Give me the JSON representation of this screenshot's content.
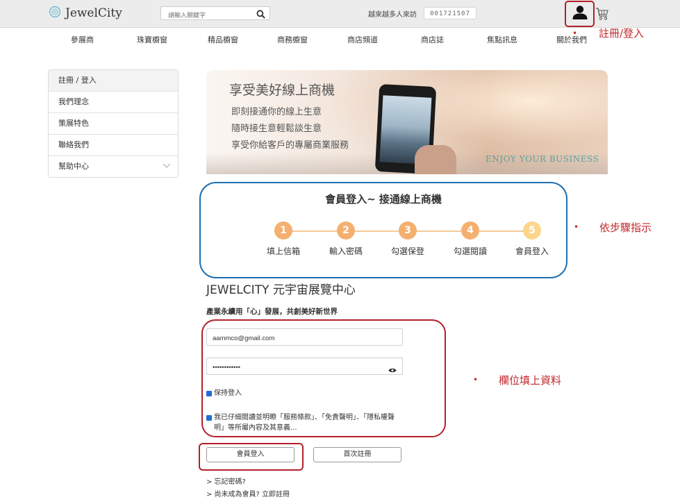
{
  "header": {
    "logo_text": "JewelCity",
    "search_placeholder": "請輸入關鍵字",
    "visitors_label": "越來越多人來訪",
    "visitor_count": "001721507"
  },
  "nav": [
    "參展商",
    "珠寶櫥窗",
    "精品櫥窗",
    "商務櫥窗",
    "商店頻道",
    "商店誌",
    "焦點訊息",
    "關於我們"
  ],
  "annotations": {
    "register_login": "註冊/登入",
    "step_guide": "依步驟指示",
    "fill_fields": "欄位填上資料"
  },
  "sidebar": {
    "items": [
      {
        "label": "註冊 / 登入"
      },
      {
        "label": "我們理念"
      },
      {
        "label": "策展特色"
      },
      {
        "label": "聯絡我們"
      },
      {
        "label": "幫助中心"
      }
    ]
  },
  "banner": {
    "title": "享受美好線上商機",
    "line1": "即刻接通你的線上生意",
    "line2": "隨時接生意輕鬆談生意",
    "line3": "享受你給客戶的專屬商業服務",
    "tagline": "ENJOY YOUR BUSINESS"
  },
  "steps": {
    "title": "會員登入~ 接通線上商機",
    "items": [
      {
        "num": "1",
        "label": "填上信箱"
      },
      {
        "num": "2",
        "label": "輸入密碼"
      },
      {
        "num": "3",
        "label": "勾選保登"
      },
      {
        "num": "4",
        "label": "勾選閱讀"
      },
      {
        "num": "5",
        "label": "會員登入"
      }
    ]
  },
  "form": {
    "heading": "JEWELCITY 元宇宙展覽中心",
    "slogan": "產業永續用「心」發展，共創美好新世界",
    "email_value": "aammco@gmail.com",
    "password_value": "••••••••••••",
    "keep_login_label": "保持登入",
    "terms_label": "我已仔細閱讀並明瞭「服務條款」、「免責聲明」、「隱私權聲明」等所屬內容及其意義...",
    "keep_login_checked": true,
    "terms_checked": true,
    "login_button": "會員登入",
    "register_button": "首次註冊",
    "forgot_link": "> 忘記密碼?",
    "not_member_link": "> 尚未成為會員? 立即註冊"
  },
  "colors": {
    "annotation_red": "#c0282b",
    "step_box_blue": "#1f6fb2",
    "step_orange": "#f5b070",
    "checkbox_blue": "#1f6fd0"
  }
}
